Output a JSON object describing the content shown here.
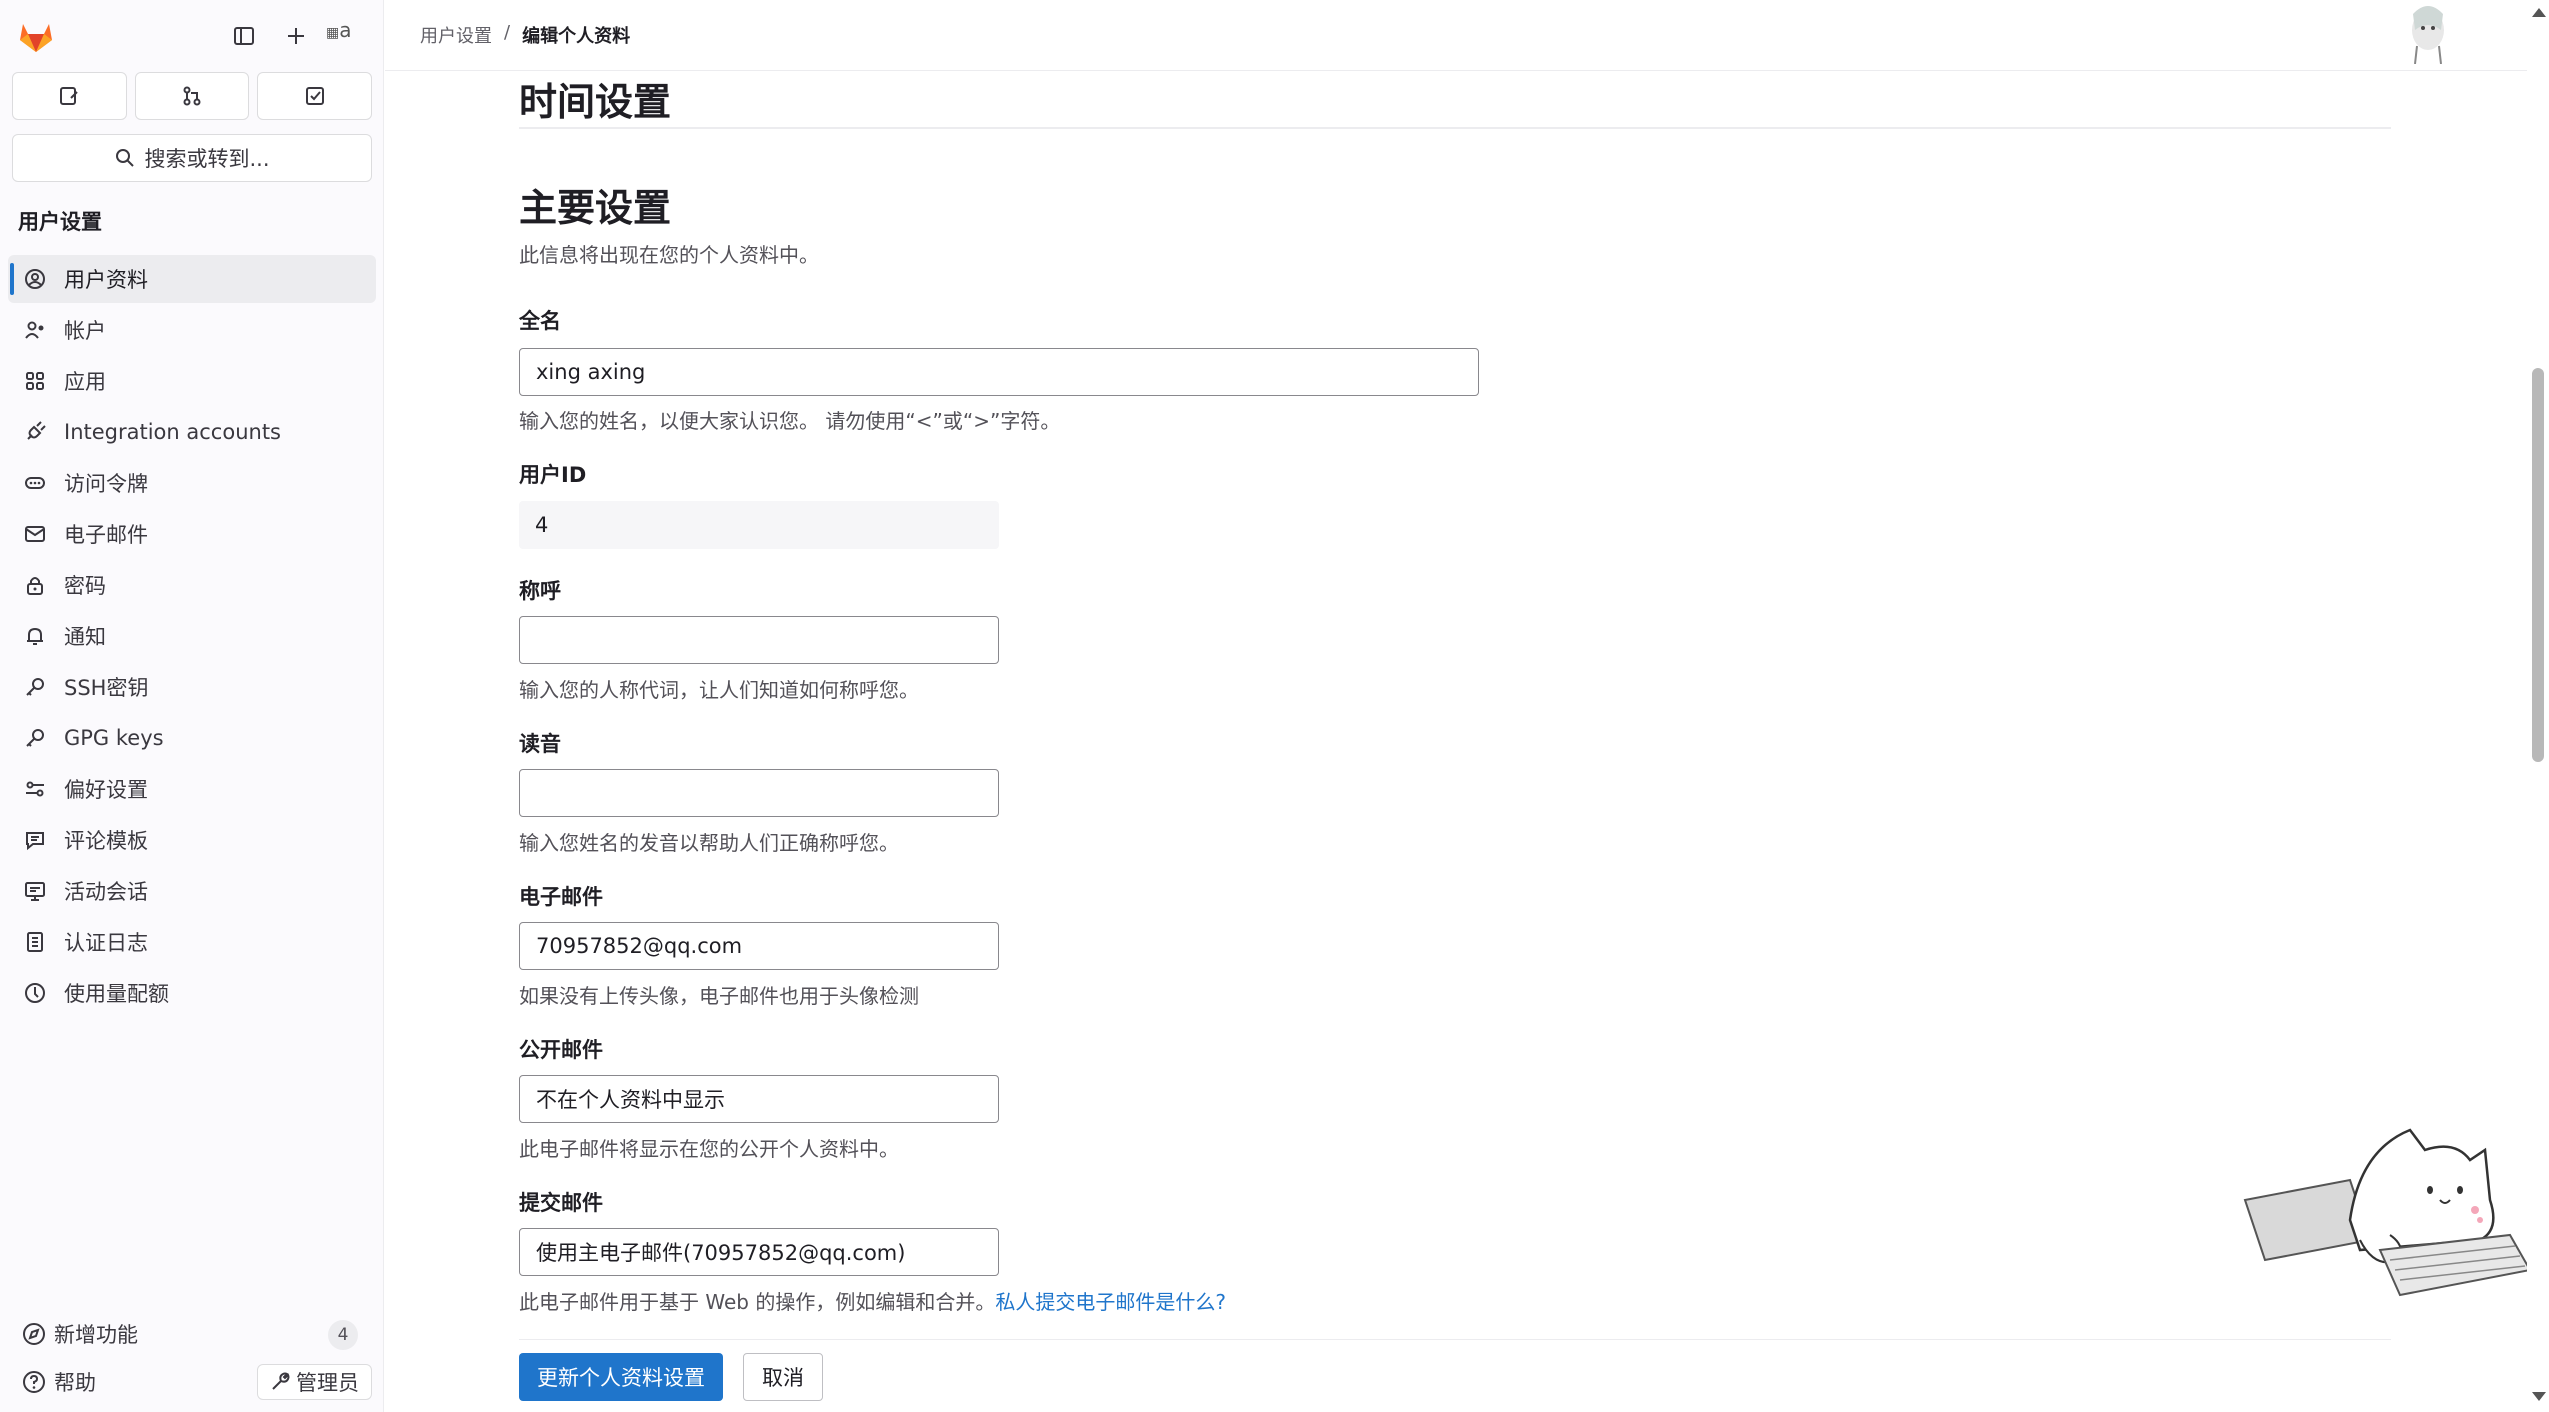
{
  "sidebar": {
    "search_label": "搜索或转到...",
    "section_title": "用户设置",
    "items": [
      {
        "label": "用户资料",
        "icon": "user-profile-icon",
        "active": true
      },
      {
        "label": "帐户",
        "icon": "account-icon"
      },
      {
        "label": "应用",
        "icon": "applications-icon"
      },
      {
        "label": "Integration accounts",
        "icon": "plug-icon"
      },
      {
        "label": "访问令牌",
        "icon": "token-icon"
      },
      {
        "label": "电子邮件",
        "icon": "mail-icon"
      },
      {
        "label": "密码",
        "icon": "lock-icon"
      },
      {
        "label": "通知",
        "icon": "bell-icon"
      },
      {
        "label": "SSH密钥",
        "icon": "key-icon"
      },
      {
        "label": "GPG keys",
        "icon": "key-icon"
      },
      {
        "label": "偏好设置",
        "icon": "preferences-icon"
      },
      {
        "label": "评论模板",
        "icon": "comment-icon"
      },
      {
        "label": "活动会话",
        "icon": "monitor-icon"
      },
      {
        "label": "认证日志",
        "icon": "log-icon"
      },
      {
        "label": "使用量配额",
        "icon": "quota-icon"
      }
    ],
    "whats_new": "新增功能",
    "whats_new_count": "4",
    "help": "帮助",
    "admin": "管理员",
    "avatar_alt": "a"
  },
  "breadcrumb": {
    "parent": "用户设置",
    "separator": "/",
    "current": "编辑个人资料"
  },
  "main": {
    "time_heading": "时间设置",
    "main_heading": "主要设置",
    "main_description": "此信息将出现在您的个人资料中。",
    "full_name": {
      "label": "全名",
      "value": "xing axing",
      "help": "输入您的姓名，以便大家认识您。 请勿使用“<”或“>”字符。"
    },
    "user_id": {
      "label": "用户ID",
      "value": "4"
    },
    "pronouns": {
      "label": "称呼",
      "value": "",
      "help": "输入您的人称代词，让人们知道如何称呼您。"
    },
    "pronunciation": {
      "label": "读音",
      "value": "",
      "help": "输入您姓名的发音以帮助人们正确称呼您。"
    },
    "email": {
      "label": "电子邮件",
      "value": "70957852@qq.com",
      "help": "如果没有上传头像，电子邮件也用于头像检测"
    },
    "public_email": {
      "label": "公开邮件",
      "value": "不在个人资料中显示",
      "help": "此电子邮件将显示在您的公开个人资料中。"
    },
    "commit_email": {
      "label": "提交邮件",
      "value": "使用主电子邮件(70957852@qq.com)",
      "help": "此电子邮件用于基于 Web 的操作，例如编辑和合并。",
      "help_link": "私人提交电子邮件是什么?"
    },
    "submit_button": "更新个人资料设置",
    "cancel_button": "取消"
  },
  "colors": {
    "accent": "#1f75cb",
    "logo_orange": "#fc6d26",
    "logo_red": "#e24329"
  }
}
